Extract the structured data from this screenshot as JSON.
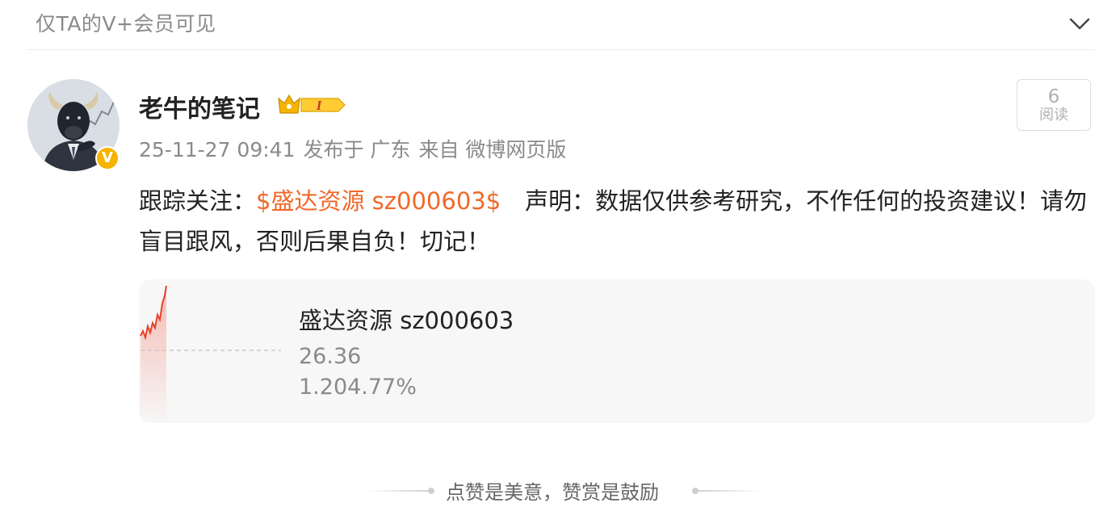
{
  "visibility": {
    "label": "仅TA的V+会员可见"
  },
  "post": {
    "author": "老牛的笔记",
    "vip_level": "I",
    "meta": {
      "datetime": "25-11-27 09:41",
      "location": "发布于 广东",
      "source": "来自 微博网页版"
    },
    "read_count": "6",
    "read_label": "阅读",
    "content": {
      "prefix": "跟踪关注：",
      "stock_tag": "$盛达资源 sz000603$",
      "body": "声明：数据仅供参考研究，不作任何的投资建议！请勿盲目跟风，否则后果自负！切记！"
    }
  },
  "stock_card": {
    "name": "盛达资源 sz000603",
    "price": "26.36",
    "change": "1.204.77%"
  },
  "footer": {
    "text": "点赞是美意，赞赏是鼓励"
  },
  "colors": {
    "accent": "#f0692a",
    "spark": "#e8402a",
    "vip_gold": "#f5b400"
  }
}
